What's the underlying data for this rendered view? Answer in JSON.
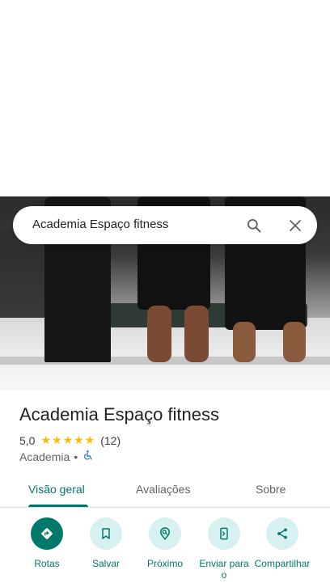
{
  "search": {
    "query": "Academia Espaço fitness"
  },
  "place": {
    "title": "Academia Espaço fitness",
    "rating": "5,0",
    "stars": "★★★★★",
    "review_count": "(12)",
    "category": "Academia",
    "separator": "•"
  },
  "tabs": [
    {
      "label": "Visão geral"
    },
    {
      "label": "Avaliações"
    },
    {
      "label": "Sobre"
    }
  ],
  "actions": [
    {
      "label": "Rotas"
    },
    {
      "label": "Salvar"
    },
    {
      "label": "Próximo"
    },
    {
      "label": "Enviar para o"
    },
    {
      "label": "Compartilhar"
    }
  ],
  "colors": {
    "accent": "#00796b",
    "star": "#fbbc04",
    "action_bg": "#d7f1f1"
  }
}
